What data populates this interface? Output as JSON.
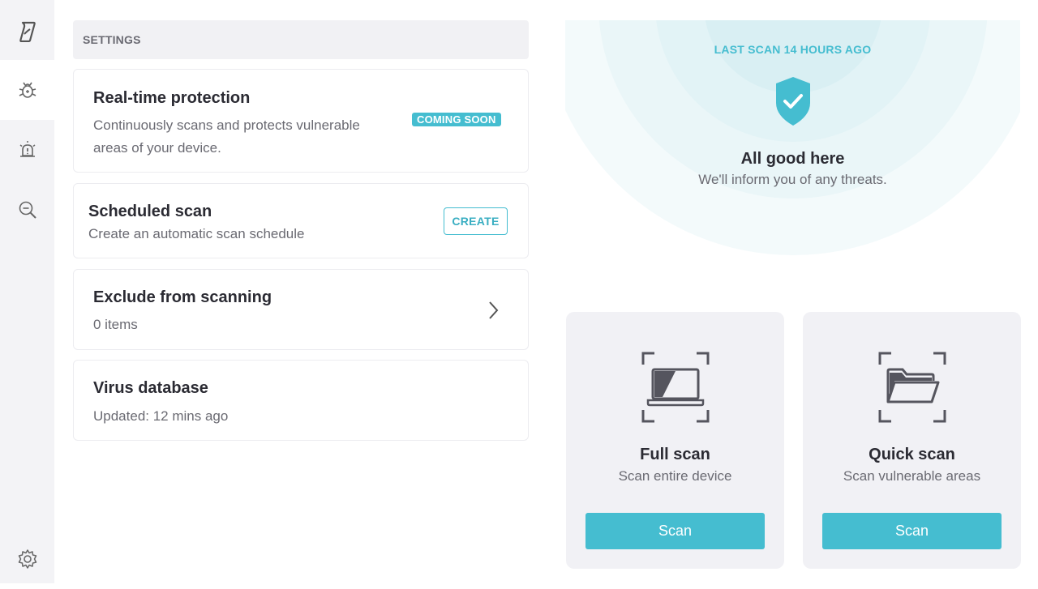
{
  "sidebar": {
    "items": [
      {
        "icon": "surfshark-logo-icon"
      },
      {
        "icon": "antivirus-bug-icon",
        "active": true
      },
      {
        "icon": "alert-siren-icon"
      },
      {
        "icon": "search-zoom-icon"
      }
    ],
    "settings_icon": "gear-icon"
  },
  "settings": {
    "header": "SETTINGS",
    "realtime": {
      "title": "Real-time protection",
      "desc_line1": "Continuously scans and protects vulnerable",
      "desc_line2": "areas of your device.",
      "badge": "COMING SOON"
    },
    "scheduled": {
      "title": "Scheduled scan",
      "desc": "Create an automatic scan schedule",
      "button": "CREATE"
    },
    "exclude": {
      "title": "Exclude from scanning",
      "desc": "0 items"
    },
    "database": {
      "title": "Virus database",
      "desc": "Updated: 12 mins ago"
    }
  },
  "status": {
    "last_scan": "LAST SCAN 14 HOURS AGO",
    "title": "All good here",
    "subtitle": "We'll inform you of any threats."
  },
  "scans": {
    "full": {
      "title": "Full scan",
      "desc": "Scan entire device",
      "button": "Scan"
    },
    "quick": {
      "title": "Quick scan",
      "desc": "Scan vulnerable areas",
      "button": "Scan"
    }
  },
  "colors": {
    "accent": "#45bdd0",
    "sidebar_bg": "#f3f3f6",
    "card_bg": "#f1f1f5"
  }
}
